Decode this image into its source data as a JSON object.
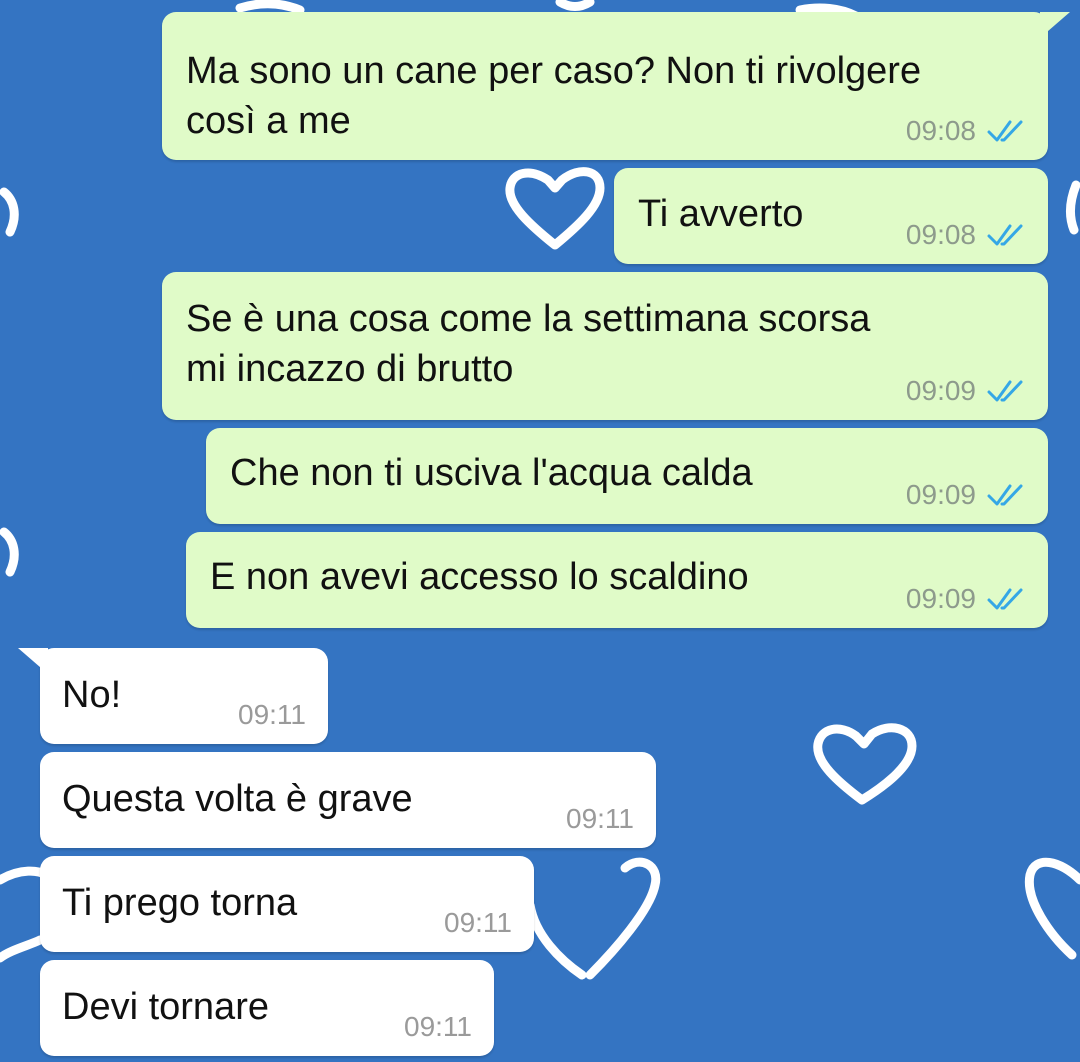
{
  "theme": {
    "background": "#3474c2",
    "outgoing_bubble": "#e0fbc8",
    "incoming_bubble": "#ffffff",
    "read_ticks": "#35a7e6"
  },
  "wallpaper": {
    "pattern_icon": "heart-outline-icon"
  },
  "messages": [
    {
      "direction": "outgoing",
      "text_lines": [
        "Ma sono un cane per caso? Non ti rivolgere",
        "così a me"
      ],
      "time": "09:08",
      "status_icon": "double-check-read-icon"
    },
    {
      "direction": "outgoing",
      "text_lines": [
        "Ti avverto"
      ],
      "time": "09:08",
      "status_icon": "double-check-read-icon"
    },
    {
      "direction": "outgoing",
      "text_lines": [
        "Se è una cosa come la settimana scorsa",
        "mi incazzo di brutto"
      ],
      "time": "09:09",
      "status_icon": "double-check-read-icon"
    },
    {
      "direction": "outgoing",
      "text_lines": [
        "Che non ti usciva l'acqua calda"
      ],
      "time": "09:09",
      "status_icon": "double-check-read-icon"
    },
    {
      "direction": "outgoing",
      "text_lines": [
        "E non avevi accesso lo scaldino"
      ],
      "time": "09:09",
      "status_icon": "double-check-read-icon"
    },
    {
      "direction": "incoming",
      "text_lines": [
        "No!"
      ],
      "time": "09:11"
    },
    {
      "direction": "incoming",
      "text_lines": [
        "Questa volta è grave"
      ],
      "time": "09:11"
    },
    {
      "direction": "incoming",
      "text_lines": [
        "Ti prego torna"
      ],
      "time": "09:11"
    },
    {
      "direction": "incoming",
      "text_lines": [
        "Devi tornare"
      ],
      "time": "09:11"
    }
  ]
}
